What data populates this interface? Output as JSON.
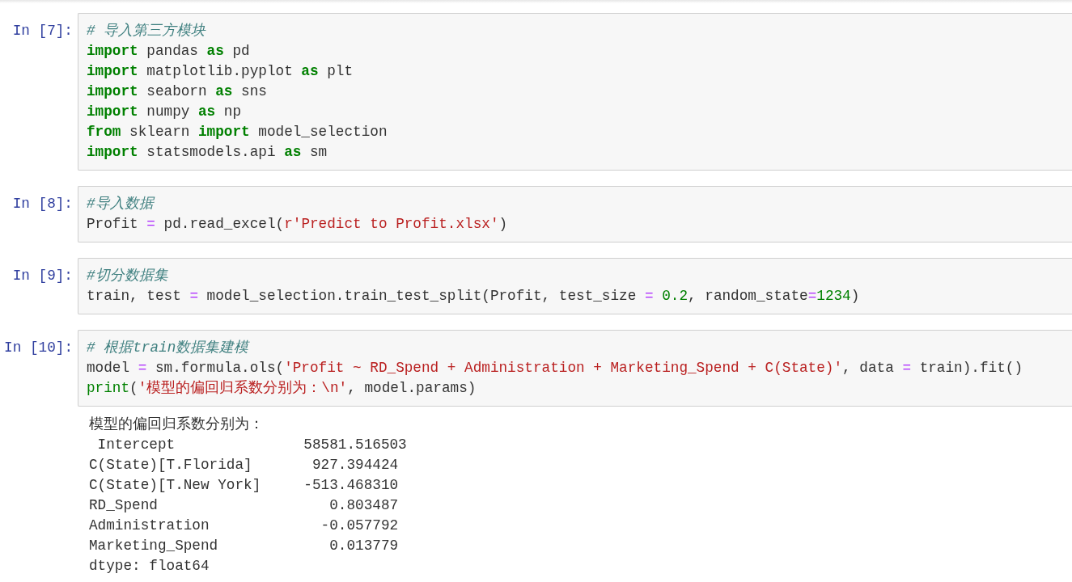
{
  "cells": [
    {
      "prompt": "In [7]:",
      "lines": [
        [
          {
            "kind": "comment",
            "text": "# 导入第三方模块"
          }
        ],
        [
          {
            "kind": "kw",
            "text": "import"
          },
          {
            "kind": "plain",
            "text": " pandas "
          },
          {
            "kind": "kw",
            "text": "as"
          },
          {
            "kind": "plain",
            "text": " pd"
          }
        ],
        [
          {
            "kind": "kw",
            "text": "import"
          },
          {
            "kind": "plain",
            "text": " matplotlib.pyplot "
          },
          {
            "kind": "kw",
            "text": "as"
          },
          {
            "kind": "plain",
            "text": " plt"
          }
        ],
        [
          {
            "kind": "kw",
            "text": "import"
          },
          {
            "kind": "plain",
            "text": " seaborn "
          },
          {
            "kind": "kw",
            "text": "as"
          },
          {
            "kind": "plain",
            "text": " sns"
          }
        ],
        [
          {
            "kind": "kw",
            "text": "import"
          },
          {
            "kind": "plain",
            "text": " numpy "
          },
          {
            "kind": "kw",
            "text": "as"
          },
          {
            "kind": "plain",
            "text": " np"
          }
        ],
        [
          {
            "kind": "kw",
            "text": "from"
          },
          {
            "kind": "plain",
            "text": " sklearn "
          },
          {
            "kind": "kw",
            "text": "import"
          },
          {
            "kind": "plain",
            "text": " model_selection"
          }
        ],
        [
          {
            "kind": "kw",
            "text": "import"
          },
          {
            "kind": "plain",
            "text": " statsmodels.api "
          },
          {
            "kind": "kw",
            "text": "as"
          },
          {
            "kind": "plain",
            "text": " sm"
          }
        ]
      ]
    },
    {
      "prompt": "In [8]:",
      "lines": [
        [
          {
            "kind": "comment",
            "text": "#导入数据"
          }
        ],
        [
          {
            "kind": "plain",
            "text": "Profit "
          },
          {
            "kind": "op",
            "text": "="
          },
          {
            "kind": "plain",
            "text": " pd.read_excel("
          },
          {
            "kind": "str",
            "text": "r'Predict to Profit.xlsx'"
          },
          {
            "kind": "plain",
            "text": ")"
          }
        ]
      ]
    },
    {
      "prompt": "In [9]:",
      "lines": [
        [
          {
            "kind": "comment",
            "text": "#切分数据集"
          }
        ],
        [
          {
            "kind": "plain",
            "text": "train, test "
          },
          {
            "kind": "op",
            "text": "="
          },
          {
            "kind": "plain",
            "text": " model_selection.train_test_split(Profit, test_size "
          },
          {
            "kind": "op",
            "text": "="
          },
          {
            "kind": "num",
            "text": " 0.2"
          },
          {
            "kind": "plain",
            "text": ", random_state"
          },
          {
            "kind": "op",
            "text": "="
          },
          {
            "kind": "num",
            "text": "1234"
          },
          {
            "kind": "plain",
            "text": ")"
          }
        ]
      ]
    },
    {
      "prompt": "In [10]:",
      "lines": [
        [
          {
            "kind": "comment",
            "text": "# 根据train数据集建模"
          }
        ],
        [
          {
            "kind": "plain",
            "text": "model "
          },
          {
            "kind": "op",
            "text": "="
          },
          {
            "kind": "plain",
            "text": " sm.formula.ols("
          },
          {
            "kind": "str",
            "text": "'Profit ~ RD_Spend + Administration + Marketing_Spend + C(State)'"
          },
          {
            "kind": "plain",
            "text": ", data "
          },
          {
            "kind": "op",
            "text": "="
          },
          {
            "kind": "plain",
            "text": " train).fit()"
          }
        ],
        [
          {
            "kind": "builtin",
            "text": "print"
          },
          {
            "kind": "plain",
            "text": "("
          },
          {
            "kind": "str",
            "text": "'模型的偏回归系数分别为：\\n'"
          },
          {
            "kind": "plain",
            "text": ", model.params)"
          }
        ]
      ],
      "output": [
        "模型的偏回归系数分别为：",
        " Intercept               58581.516503",
        "C(State)[T.Florida]       927.394424",
        "C(State)[T.New York]     -513.468310",
        "RD_Spend                    0.803487",
        "Administration             -0.057792",
        "Marketing_Spend             0.013779",
        "dtype: float64"
      ]
    }
  ]
}
